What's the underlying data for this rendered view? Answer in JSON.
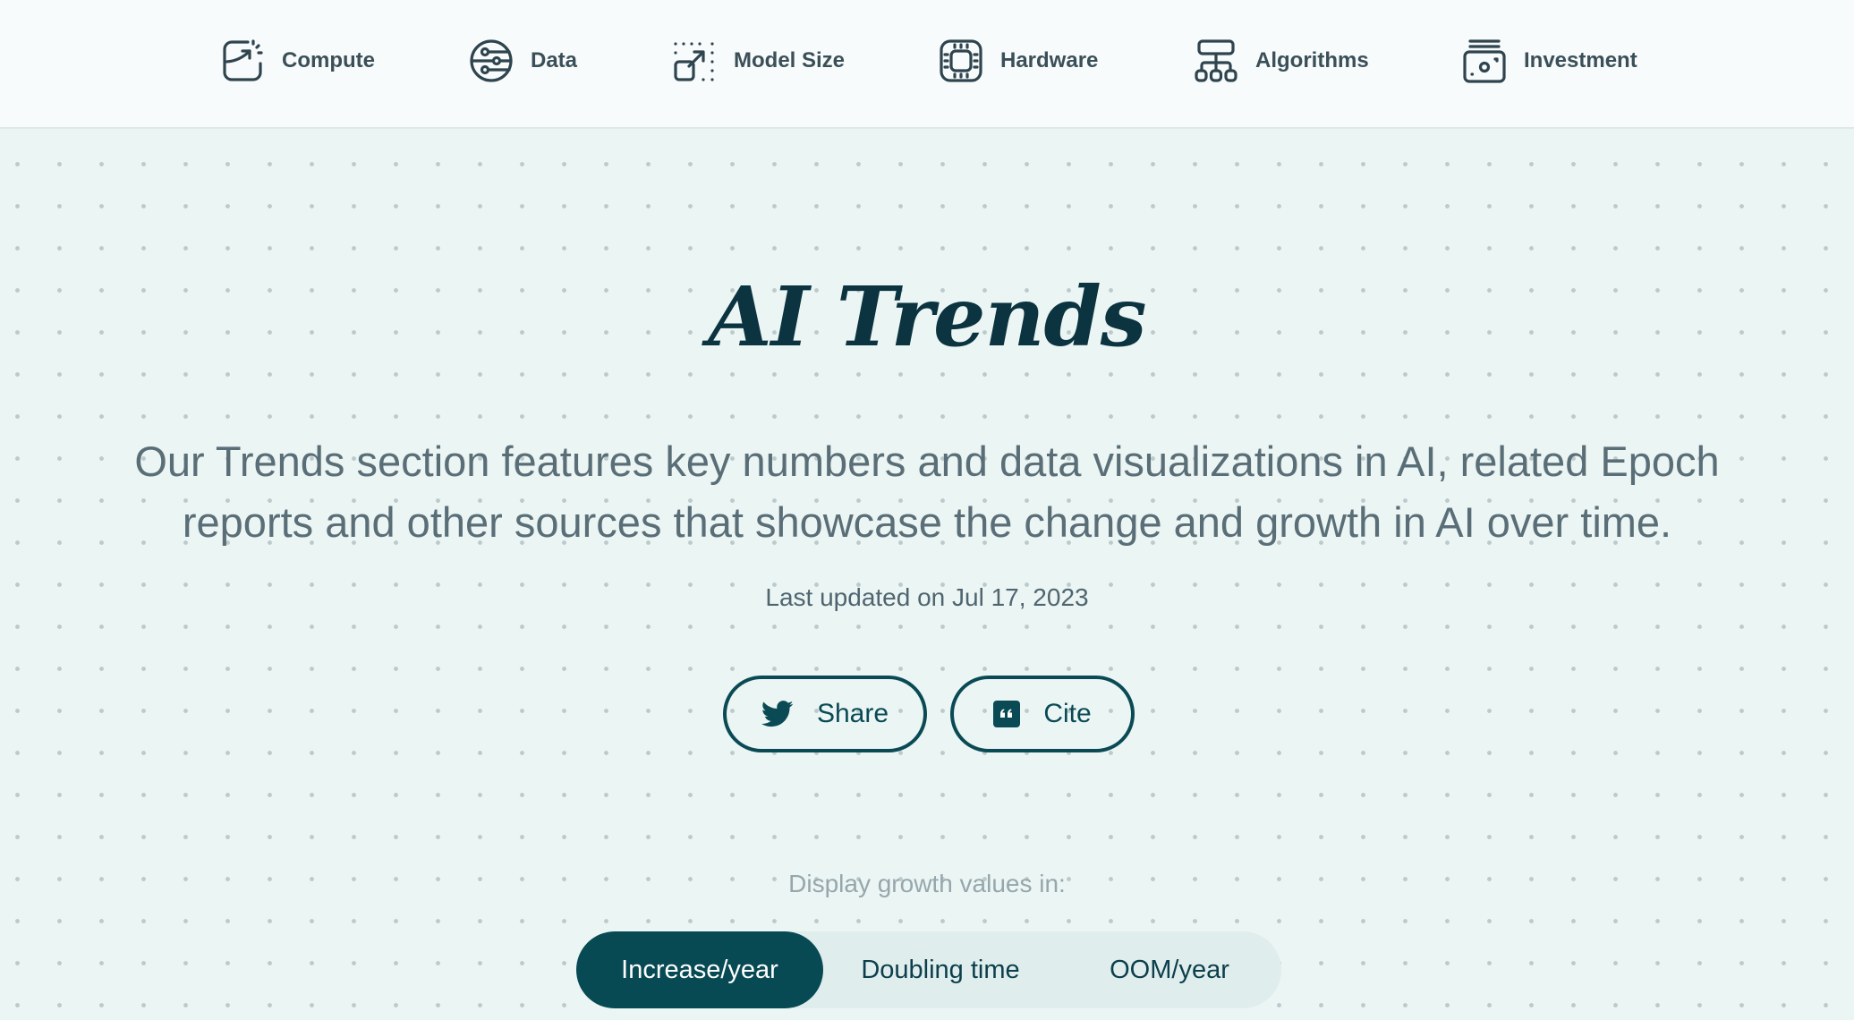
{
  "nav": {
    "items": [
      {
        "label": "Compute",
        "icon": "compute-icon"
      },
      {
        "label": "Data",
        "icon": "data-icon"
      },
      {
        "label": "Model Size",
        "icon": "model-size-icon"
      },
      {
        "label": "Hardware",
        "icon": "hardware-chip-icon"
      },
      {
        "label": "Algorithms",
        "icon": "algorithms-hierarchy-icon"
      },
      {
        "label": "Investment",
        "icon": "investment-money-icon"
      }
    ]
  },
  "hero": {
    "title": "AI Trends",
    "description": "Our Trends section features key numbers and data visualizations in AI, related Epoch reports and other sources that showcase the change and growth in AI over time.",
    "last_updated": "Last updated on Jul 17, 2023"
  },
  "actions": {
    "share_label": "Share",
    "share_icon": "twitter-icon",
    "cite_label": "Cite",
    "cite_icon": "quote-icon"
  },
  "growth": {
    "label": "Display growth values in:",
    "options": [
      "Increase/year",
      "Doubling time",
      "OOM/year"
    ],
    "selected": "Increase/year"
  },
  "colors": {
    "primary": "#074a54",
    "title": "#0b3340",
    "nav_text": "#3b4f59",
    "background": "#ebf5f3"
  }
}
